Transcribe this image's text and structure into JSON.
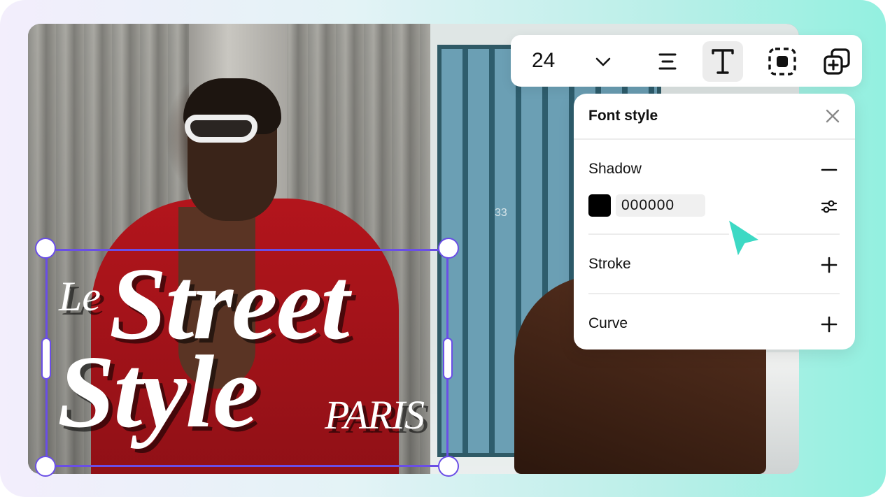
{
  "toolbar": {
    "font_size": "24",
    "icons": [
      "chevron-down-icon",
      "align-center-icon",
      "text-icon",
      "focus-frame-icon",
      "add-layer-icon"
    ],
    "active_tool": "text"
  },
  "canvas": {
    "door_number": "33",
    "title_text": {
      "le": "Le",
      "street": "Street",
      "style": "Style",
      "paris": "PARIS"
    }
  },
  "font_style_panel": {
    "title": "Font style",
    "shadow": {
      "label": "Shadow",
      "color_value": "000000",
      "swatch_color": "#000000"
    },
    "stroke": {
      "label": "Stroke"
    },
    "curve": {
      "label": "Curve"
    }
  },
  "colors": {
    "selection": "#6a4ee6",
    "cursor": "#3dd9c4"
  }
}
